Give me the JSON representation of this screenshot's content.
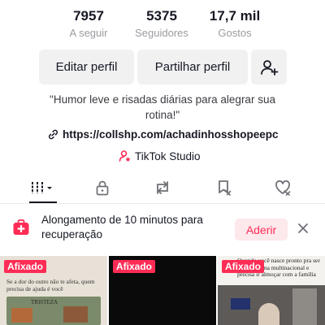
{
  "stats": {
    "following": {
      "value": "7957",
      "label": "A seguir"
    },
    "followers": {
      "value": "5375",
      "label": "Seguidores"
    },
    "likes": {
      "value": "17,7 mil",
      "label": "Gostos"
    }
  },
  "actions": {
    "edit_label": "Editar perfil",
    "share_label": "Partilhar perfil",
    "add_friend_icon": "add-user-icon"
  },
  "bio": {
    "text": "\"Humor leve e risadas diárias para alegrar sua rotina!\""
  },
  "link": {
    "icon": "link-icon",
    "url": "https://collshp.com/achadinhosshopeepc"
  },
  "studio": {
    "icon": "tiktok-studio-icon",
    "label": "TikTok Studio"
  },
  "tabs": [
    {
      "name": "videos",
      "icon": "grid-icon",
      "active": true
    },
    {
      "name": "private",
      "icon": "lock-icon"
    },
    {
      "name": "reposts",
      "icon": "repost-icon"
    },
    {
      "name": "saved",
      "icon": "bookmark-icon"
    },
    {
      "name": "liked",
      "icon": "heart-icon"
    }
  ],
  "banner": {
    "icon": "medical-kit-icon",
    "text": "Alongamento de 10 minutos para recuperação",
    "accept_label": "Aderir",
    "close_icon": "close-icon"
  },
  "videos": [
    {
      "pinned_label": "Afixado",
      "caption_1": "Se a dor do outro não te afeta, quem precisa de ajuda é você",
      "caption_2": "TRISTEZA"
    },
    {
      "pinned_label": "Afixado"
    },
    {
      "pinned_label": "Afixado",
      "caption_1": "Quando você nasce pronto pra ser chefe de uma multinacional e precisa ir almoçar com a família"
    }
  ],
  "colors": {
    "accent": "#fe2c55",
    "accent_soft": "#fde8ec",
    "text": "#161823",
    "muted": "#9a9ba0",
    "button_bg": "#f1f1f2"
  }
}
